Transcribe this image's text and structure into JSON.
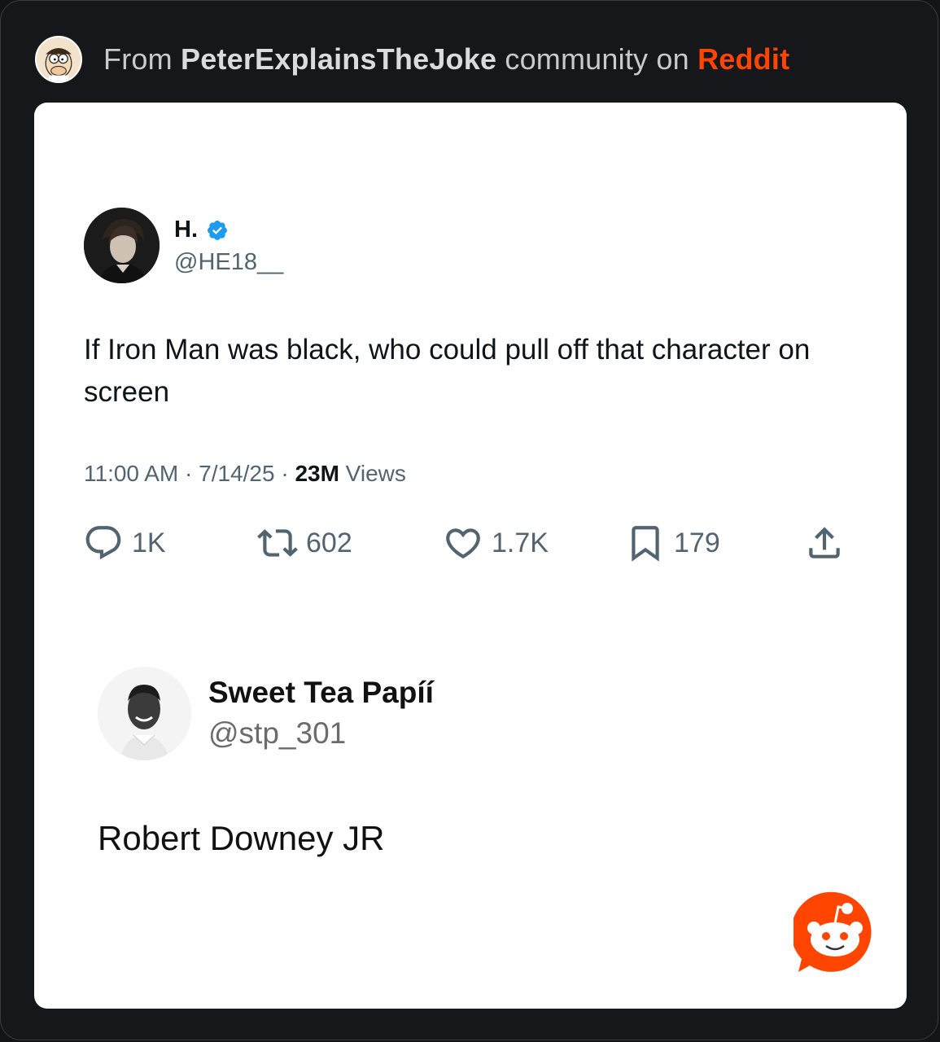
{
  "header": {
    "prefix": "From ",
    "community": "PeterExplainsTheJoke",
    "middle": " community on ",
    "platform": "Reddit",
    "avatar_icon": "family-guy-peter-avatar",
    "platform_color": "#ff4500"
  },
  "tweet": {
    "name": "H.",
    "handle": "@HE18__",
    "verified_icon": "verified-badge-icon",
    "text": "If Iron Man was black, who could pull off that character on screen",
    "time": "11:00 AM",
    "sep1": " · ",
    "date": "7/14/25",
    "sep2": " · ",
    "views_count": "23M",
    "views_label": " Views",
    "actions": {
      "replies": "1K",
      "reposts": "602",
      "likes": "1.7K",
      "bookmarks": "179"
    }
  },
  "reply": {
    "name": "Sweet Tea Papíí",
    "handle": "@stp_301",
    "text": "Robert Downey JR"
  },
  "badge": {
    "icon": "reddit-snoo-icon",
    "color": "#ff4500"
  }
}
